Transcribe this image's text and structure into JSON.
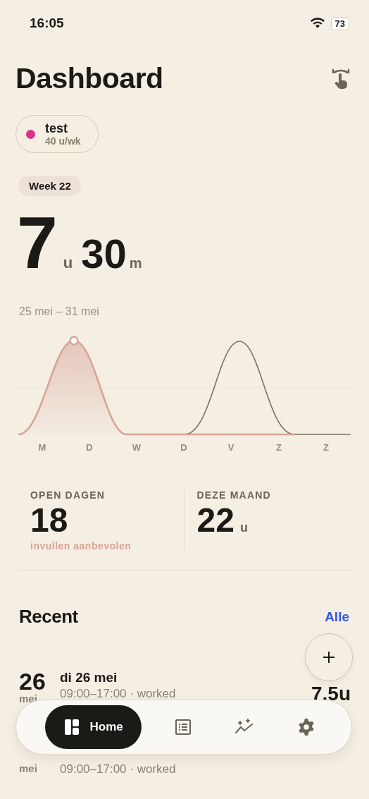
{
  "status_bar": {
    "time": "16:05",
    "battery": "73"
  },
  "title": "Dashboard",
  "project": {
    "name": "test",
    "hours": "40 u/wk",
    "color": "#d63384"
  },
  "week_badge": "Week 22",
  "total": {
    "hours": "7",
    "hours_unit": "u",
    "minutes": "30",
    "minutes_unit": "m"
  },
  "range": "25 mei – 31 mei",
  "chart": {
    "day_labels": [
      "M",
      "D",
      "W",
      "D",
      "V",
      "Z",
      "Z"
    ]
  },
  "stats": [
    {
      "label": "OPEN DAGEN",
      "value": "18",
      "note": "invullen aanbevolen"
    },
    {
      "label": "DEZE MAAND",
      "value": "22",
      "unit": "u"
    }
  ],
  "recent": {
    "title": "Recent",
    "link": "Alle",
    "rows": [
      {
        "day": "26",
        "month": "mei",
        "date": "di 26 mei",
        "detail": "09:00–17:00 · worked",
        "hours": "7.5u"
      },
      {
        "month": "mei",
        "detail": "09:00–17:00 · worked"
      }
    ]
  },
  "nav": {
    "items": [
      {
        "kind": "home",
        "label": "Home",
        "selected": true
      },
      {
        "kind": "list",
        "selected": false
      },
      {
        "kind": "insights",
        "selected": false
      },
      {
        "kind": "settings",
        "selected": false
      }
    ]
  }
}
